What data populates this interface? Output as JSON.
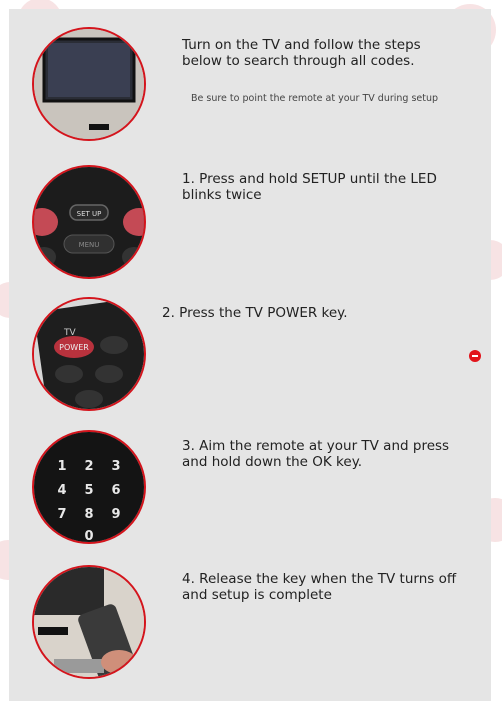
{
  "intro": {
    "title": "Turn on the TV and follow the steps below to search through all codes.",
    "note": "Be sure to point the remote at your TV during setup"
  },
  "steps": [
    {
      "text": "1. Press and hold SETUP until the LED blinks twice",
      "key_label": "SET UP",
      "menu_label": "MENU"
    },
    {
      "text": "2. Press the TV POWER key.",
      "tv_label": "TV",
      "power_label": "POWER"
    },
    {
      "text": "3. Aim the remote at your TV and press and hold down the OK key.",
      "digits": [
        "1",
        "2",
        "3",
        "4",
        "5",
        "6",
        "7",
        "8",
        "9",
        "0"
      ]
    },
    {
      "text": "4. Release the key when the TV turns off and setup is complete"
    }
  ],
  "colors": {
    "accent": "#d4141c",
    "panel": "#e5e5e5"
  },
  "icons": {
    "collapse": "minus-circle-icon"
  }
}
